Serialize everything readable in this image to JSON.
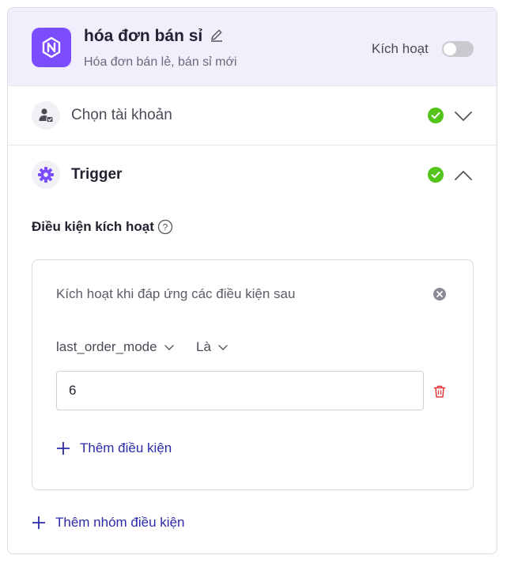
{
  "header": {
    "title": "hóa đơn bán sỉ",
    "subtitle": "Hóa đơn bán lẻ, bán sỉ mới",
    "toggle_label": "Kích hoạt",
    "toggle_on": false
  },
  "sections": {
    "account": {
      "label": "Chọn tài khoản",
      "status": "complete",
      "expanded": false
    },
    "trigger": {
      "label": "Trigger",
      "status": "complete",
      "expanded": true
    }
  },
  "conditions": {
    "heading": "Điều kiện kích hoạt",
    "group": {
      "title": "Kích hoạt khi đáp ứng các điều kiện sau",
      "field": "last_order_mode",
      "operator": "Là",
      "value": "6",
      "add_condition_label": "Thêm điều kiện"
    },
    "add_group_label": "Thêm nhóm điều kiện"
  },
  "colors": {
    "accent": "#7c4dff",
    "header_bg": "#f1effc",
    "success": "#52c41a",
    "link": "#2b2ba8",
    "danger": "#e03b3b"
  }
}
